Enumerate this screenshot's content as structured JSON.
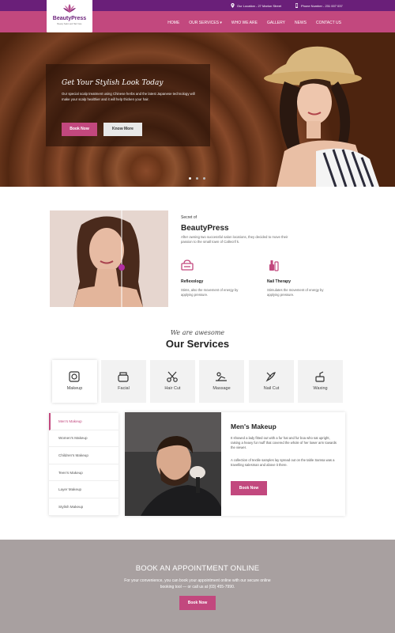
{
  "topbar": {
    "location": "Our Location - 27 Marlon Street",
    "phone": "Phone Number - 231 007 037"
  },
  "brand": {
    "name": "BeautyPress",
    "tagline": "Beauty Salon and Hair Care"
  },
  "nav": {
    "items": [
      "HOME",
      "OUR SERVICES",
      "WHO WE ARE",
      "GALLERY",
      "NEWS",
      "CONTACT US"
    ]
  },
  "hero": {
    "title": "Get Your Stylish Look Today",
    "text": "Our special scalp treatment using Chinese herbs and the latest Japanese technology will make your scalp healthier and it will help thicken your hair.",
    "book_label": "Book Now",
    "more_label": "Know More"
  },
  "about": {
    "pre": "Secret of",
    "title": "BeautyPress",
    "desc": "After owning two successful salon locations, they decided to move their passion to the small town of Callecrif k.",
    "features": [
      {
        "title": "Reflexology",
        "desc": "Stims, also the movement of energy by applying pressure."
      },
      {
        "title": "Nail Therapy",
        "desc": "Stimulates the movement of energy by applying pressure."
      }
    ]
  },
  "services": {
    "script": "We are awesome",
    "title": "Our Services",
    "cards": [
      "Makeup",
      "Facial",
      "Hair Cut",
      "Massage",
      "Nail Cut",
      "Waxing"
    ],
    "tabs": [
      "Men's Makeup",
      "Women's Makeup",
      "Children's Makeup",
      "Teen's Makeup",
      "Layer Makeup",
      "Stylish Makeup"
    ],
    "panel": {
      "title": "Men's Makeup",
      "p1": "It showed a lady fitted out with a fur hat and fur boa who sat upright, raising a heavy fur muff that covered the whole of her lower arm towards the viewer.",
      "p2": "A collection of textile samples lay spread out on the table Samsa was a travelling salesman and above it there.",
      "book_label": "Book Now"
    }
  },
  "appointment": {
    "title": "BOOK AN APPOINTMENT ONLINE",
    "text": "For your convenience, you can book your appointment online with our secure online booking tool — or call us at (03) 455-7990.",
    "book_label": "Book Now"
  },
  "colors": {
    "purple": "#6a1f79",
    "pink": "#c2487e",
    "gray_band": "#a8a0a0"
  }
}
